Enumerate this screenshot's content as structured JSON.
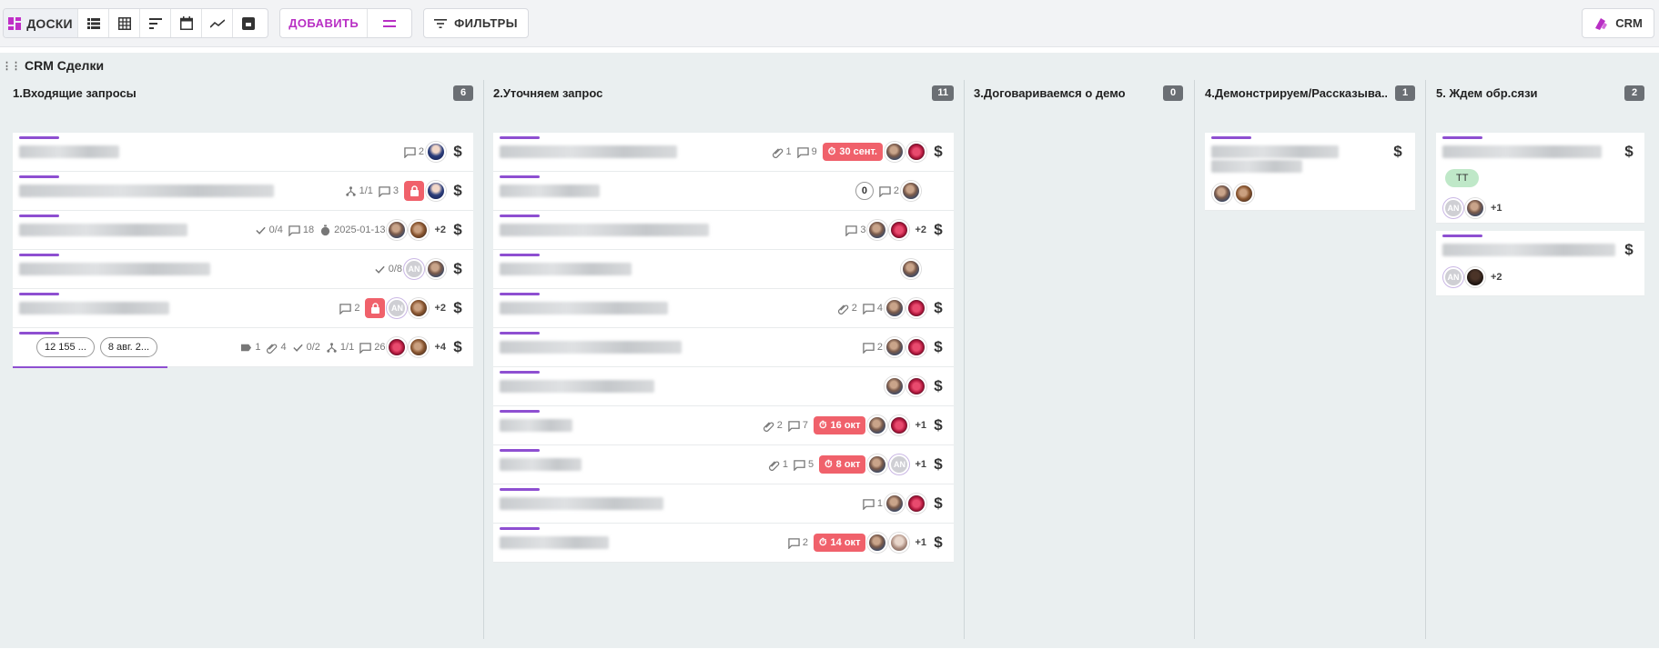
{
  "toolbar": {
    "boards_label": "ДОСКИ",
    "add_label": "ДОБАВИТЬ",
    "filters_label": "ФИЛЬТРЫ",
    "crm_label": "CRM",
    "accent_color": "#b82fc4"
  },
  "board": {
    "title": "CRM Сделки",
    "columns": [
      {
        "title": "1.Входящие запросы",
        "count": "6",
        "cards": [
          {
            "comments": "2"
          },
          {
            "subtasks": "1/1",
            "comments": "3"
          },
          {
            "checklist": "0/4",
            "comments": "18",
            "date": "2025-01-13",
            "extra": "+2"
          },
          {
            "checklist": "0/8",
            "avatar_initials": "AN"
          },
          {
            "comments": "2",
            "avatar_initials": "AN",
            "extra": "+2"
          },
          {
            "pill_amount": "12 155 ...",
            "pill_date": "8 авг. 2...",
            "tags": "1",
            "attachments": "4",
            "checklist": "0/2",
            "subtasks": "1/1",
            "comments": "26",
            "extra": "+4"
          }
        ]
      },
      {
        "title": "2.Уточняем запрос",
        "count": "11",
        "cards": [
          {
            "attachments": "1",
            "comments": "9",
            "deadline": "30 сент."
          },
          {
            "zero": "0",
            "comments": "2"
          },
          {
            "comments": "3",
            "extra": "+2"
          },
          {},
          {
            "attachments": "2",
            "comments": "4"
          },
          {
            "comments": "2"
          },
          {},
          {
            "attachments": "2",
            "comments": "7",
            "deadline": "16 окт",
            "extra": "+1"
          },
          {
            "attachments": "1",
            "comments": "5",
            "deadline": "8 окт",
            "avatar_initials": "AN",
            "extra": "+1"
          },
          {
            "comments": "1"
          },
          {
            "comments": "2",
            "deadline": "14 окт",
            "extra": "+1"
          }
        ]
      },
      {
        "title": "3.Договариваемся о демо",
        "count": "0",
        "cards": []
      },
      {
        "title": "4.Демонстрируем/Рассказыва...",
        "count": "1",
        "cards": [
          {}
        ]
      },
      {
        "title": "5. Ждем обр.сязи",
        "count": "2",
        "cards": [
          {
            "tag": "TT",
            "avatar_initials": "AN",
            "extra": "+1"
          },
          {
            "avatar_initials": "AN",
            "extra": "+2"
          }
        ]
      }
    ]
  },
  "icons": {
    "dollar": "$",
    "lock": "lock-icon",
    "comment": "comment-icon",
    "attachment": "paperclip-icon",
    "checklist": "check-icon",
    "subtask": "subtask-icon",
    "timer": "stopwatch-icon",
    "tag": "tag-icon"
  }
}
